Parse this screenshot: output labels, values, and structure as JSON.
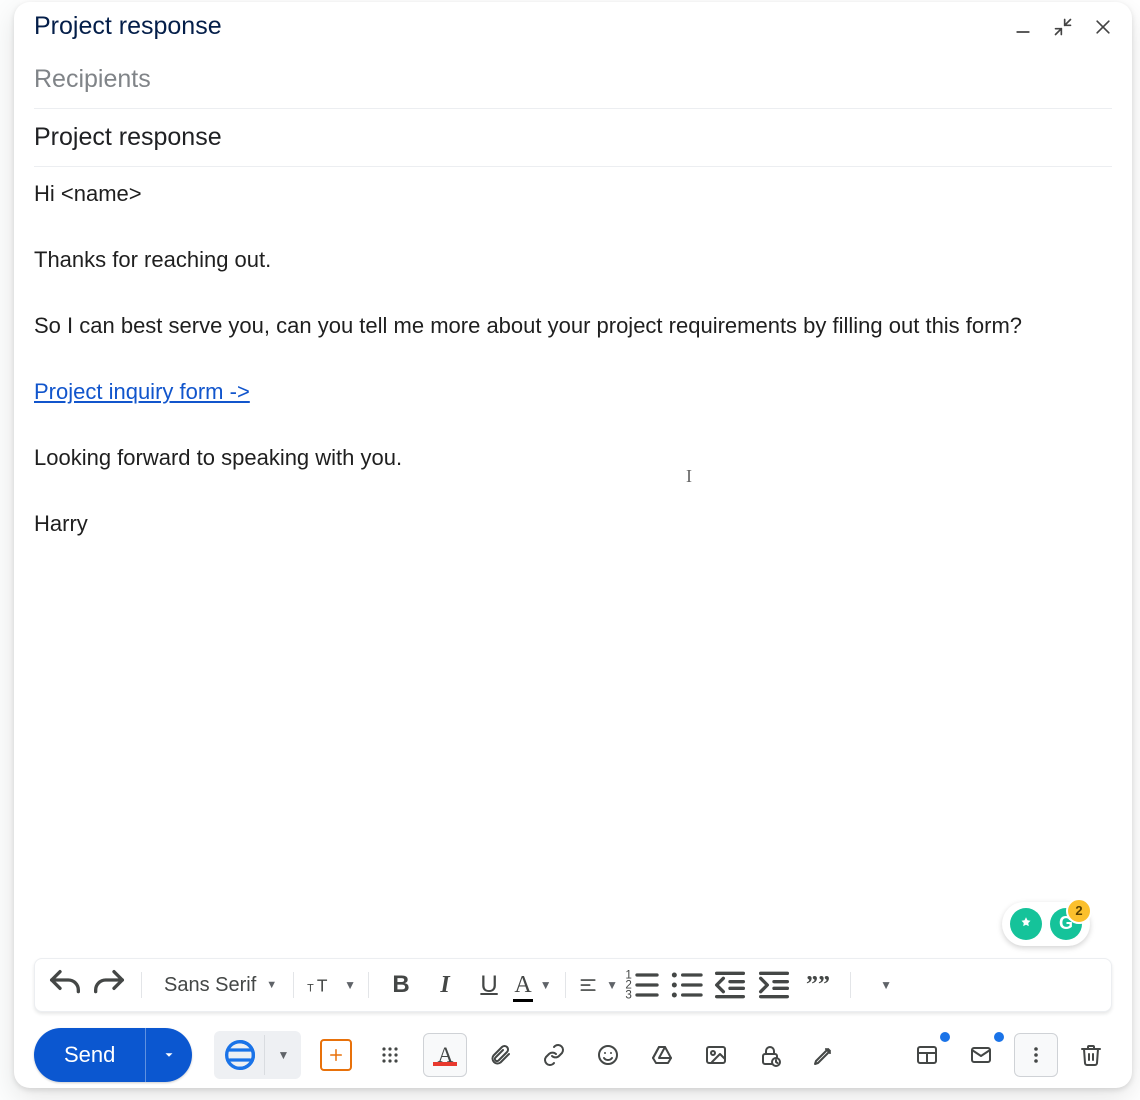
{
  "header": {
    "title": "Project response"
  },
  "recipients_placeholder": "Recipients",
  "subject": "Project response",
  "body": {
    "greeting": "Hi <name>",
    "p1": "Thanks for reaching out.",
    "p2": "So I can best serve you, can you tell me more about your project requirements by filling out this form?",
    "link_text": "Project inquiry form ->",
    "p3": "Looking forward to speaking with you.",
    "signature": "Harry"
  },
  "grammar_badge": "2",
  "grammar_letter": "G",
  "format": {
    "font": "Sans Serif"
  },
  "send_label": "Send"
}
